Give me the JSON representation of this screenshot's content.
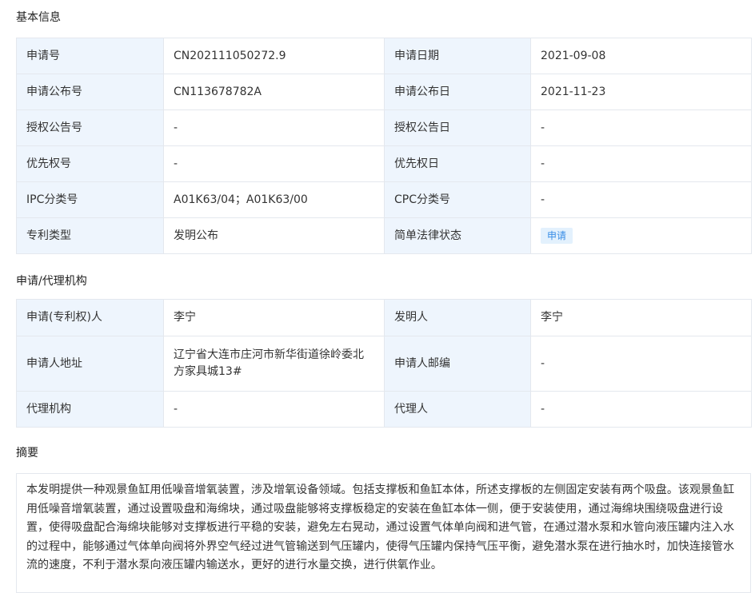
{
  "basic_info": {
    "title": "基本信息",
    "rows": [
      {
        "label1": "申请号",
        "value1": "CN202111050272.9",
        "label2": "申请日期",
        "value2": "2021-09-08"
      },
      {
        "label1": "申请公布号",
        "value1": "CN113678782A",
        "label2": "申请公布日",
        "value2": "2021-11-23"
      },
      {
        "label1": "授权公告号",
        "value1": "-",
        "label2": "授权公告日",
        "value2": "-"
      },
      {
        "label1": "优先权号",
        "value1": "-",
        "label2": "优先权日",
        "value2": "-"
      },
      {
        "label1": "IPC分类号",
        "value1": "A01K63/04；A01K63/00",
        "label2": "CPC分类号",
        "value2": "-"
      },
      {
        "label1": "专利类型",
        "value1": "发明公布",
        "label2": "简单法律状态",
        "value2": "申请"
      }
    ]
  },
  "agency_info": {
    "title": "申请/代理机构",
    "rows": [
      {
        "label1": "申请(专利权)人",
        "value1": "李宁",
        "label2": "发明人",
        "value2": "李宁"
      },
      {
        "label1": "申请人地址",
        "value1": "辽宁省大连市庄河市新华街道徐岭委北方家具城13#",
        "label2": "申请人邮编",
        "value2": "-"
      },
      {
        "label1": "代理机构",
        "value1": "-",
        "label2": "代理人",
        "value2": "-"
      }
    ]
  },
  "abstract": {
    "title": "摘要",
    "text": "本发明提供一种观景鱼缸用低噪音增氧装置，涉及增氧设备领域。包括支撑板和鱼缸本体，所述支撑板的左侧固定安装有两个吸盘。该观景鱼缸用低噪音增氧装置，通过设置吸盘和海绵块，通过吸盘能够将支撑板稳定的安装在鱼缸本体一侧，便于安装使用，通过海绵块围绕吸盘进行设置，使得吸盘配合海绵块能够对支撑板进行平稳的安装，避免左右晃动，通过设置气体单向阀和进气管，在通过潜水泵和水管向液压罐内注入水的过程中，能够通过气体单向阀将外界空气经过进气管输送到气压罐内，使得气压罐内保持气压平衡，避免潜水泵在进行抽水时，加快连接管水流的速度，不利于潜水泵向液压罐内输送水，更好的进行水量交换，进行供氧作业。"
  },
  "colors": {
    "label_bg": "#eef5fd",
    "border": "#e4e8ee",
    "badge_bg": "#e3f1fd",
    "badge_text": "#3a8ee6"
  }
}
